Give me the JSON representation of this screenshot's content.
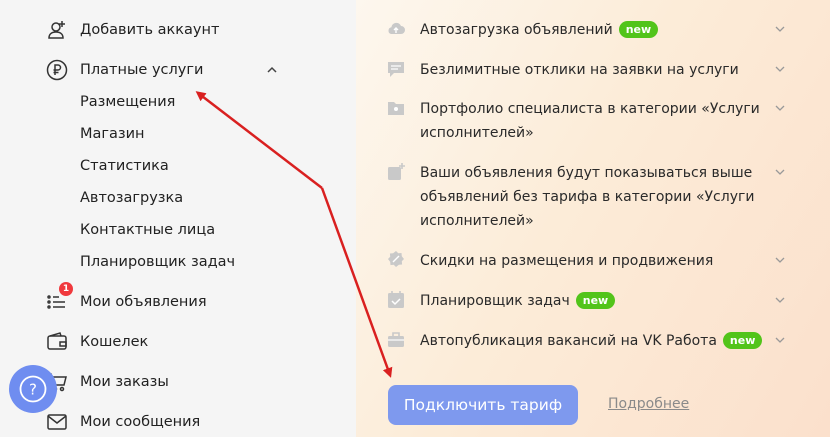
{
  "sidebar": {
    "add_account": "Добавить аккаунт",
    "paid_services": "Платные услуги",
    "sub_items": [
      "Размещения",
      "Магазин",
      "Статистика",
      "Автозагрузка",
      "Контактные лица",
      "Планировщик задач"
    ],
    "my_ads": "Мои объявления",
    "my_ads_badge": "1",
    "wallet": "Кошелек",
    "my_orders": "Мои заказы",
    "my_messages": "Мои сообщения"
  },
  "help": {
    "label": "?"
  },
  "panel": {
    "features": [
      {
        "text": "Автозагрузка объявлений",
        "badge": "new",
        "icon": "cloud-icon"
      },
      {
        "text": "Безлимитные отклики на заявки на услуги",
        "badge": "",
        "icon": "chat-icon"
      },
      {
        "text": "Портфолио специалиста в категории «Услуги исполнителей»",
        "badge": "",
        "icon": "folder-icon"
      },
      {
        "text": "Ваши объявления будут показываться выше объявлений без тарифа в категории «Услуги исполнителей»",
        "badge": "",
        "icon": "boost-icon"
      },
      {
        "text": "Скидки на размещения и продвижения",
        "badge": "",
        "icon": "discount-icon"
      },
      {
        "text": "Планировщик задач",
        "badge": "new",
        "icon": "calendar-icon"
      },
      {
        "text": "Автопубликация вакансий на VK Работа",
        "badge": "new",
        "icon": "briefcase-icon"
      }
    ],
    "cta": "Подключить тариф",
    "more": "Подробнее"
  },
  "colors": {
    "accent": "#7e99ee",
    "new_badge": "#52c41a",
    "arrow": "#d92020",
    "counter": "#f0393d"
  }
}
